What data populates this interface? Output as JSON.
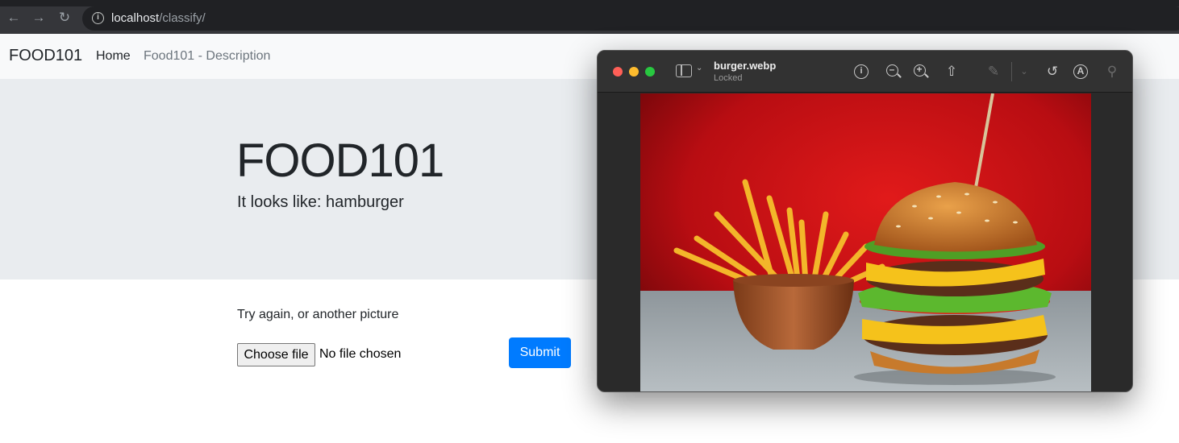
{
  "browser": {
    "back_icon": "arrow-left-icon",
    "forward_icon": "arrow-right-icon",
    "reload_icon": "reload-icon",
    "url_host": "localhost",
    "url_path": "/classify/"
  },
  "navbar": {
    "brand": "FOOD101",
    "home": "Home",
    "description": "Food101 - Description"
  },
  "jumbotron": {
    "title": "FOOD101",
    "result": "It looks like: hamburger"
  },
  "form": {
    "label": "Try again, or another picture",
    "choose_button": "Choose file",
    "file_status": "No file chosen",
    "submit": "Submit"
  },
  "preview_window": {
    "file_name": "burger.webp",
    "status": "Locked",
    "image_subject": "hamburger and fries",
    "colors": {
      "background_red": "#c8101a",
      "table": "#9aa3a8",
      "toolbar": "#323232"
    }
  },
  "colors": {
    "primary": "#007bff",
    "jumbotron_bg": "#e9ecef",
    "navbar_bg": "#f8f9fa"
  }
}
